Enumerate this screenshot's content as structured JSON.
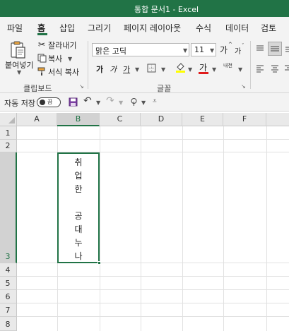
{
  "window": {
    "title": "통합 문서1  -  Excel"
  },
  "menu": {
    "tabs": [
      {
        "label": "파일"
      },
      {
        "label": "홈"
      },
      {
        "label": "삽입"
      },
      {
        "label": "그리기"
      },
      {
        "label": "페이지 레이아웃"
      },
      {
        "label": "수식"
      },
      {
        "label": "데이터"
      },
      {
        "label": "검토"
      }
    ],
    "active_index": 1
  },
  "ribbon": {
    "clipboard": {
      "paste_label": "붙여넣기",
      "cut_label": "잘라내기",
      "copy_label": "복사",
      "format_painter_label": "서식 복사",
      "group_label": "클립보드"
    },
    "font": {
      "font_name": "맑은 고딕",
      "font_size": "11",
      "bold_glyph": "가",
      "italic_glyph": "가",
      "underline_glyph": "가",
      "grow_glyph": "가",
      "shrink_glyph": "가",
      "font_color_glyph": "가",
      "phonetic_label": "내천",
      "group_label": "글꼴"
    }
  },
  "qat": {
    "autosave_label": "자동 저장",
    "autosave_state": "끔"
  },
  "sheet": {
    "columns": [
      "A",
      "B",
      "C",
      "D",
      "E",
      "F"
    ],
    "selected_column": "B",
    "rows": [
      "1",
      "2",
      "3",
      "4",
      "5",
      "6",
      "7",
      "8"
    ],
    "selected_row": "3",
    "cell_b3_chars": [
      "취",
      "업",
      "한",
      "",
      "공",
      "대",
      "누",
      "나"
    ]
  },
  "colors": {
    "accent": "#217346",
    "ribbon_bg": "#f3f3f3",
    "header_bg": "#e9e9e9"
  }
}
